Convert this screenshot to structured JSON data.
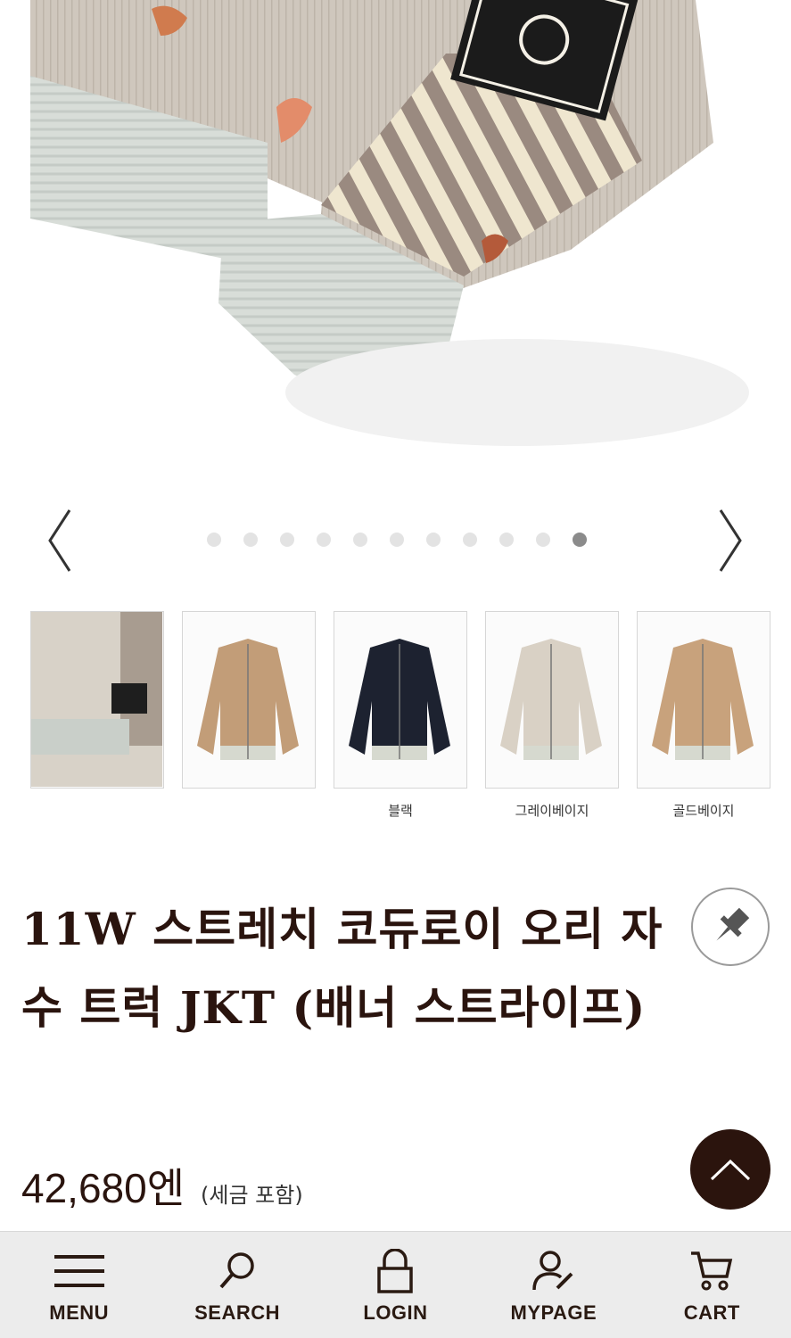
{
  "gallery": {
    "dot_count": 11,
    "active_index": 10,
    "prev_label": "previous-image",
    "next_label": "next-image"
  },
  "thumbnails": [
    {
      "label": "",
      "color": "#d8d2c8",
      "variant": "detail"
    },
    {
      "label": "",
      "color": "#c29d78",
      "variant": "tan"
    },
    {
      "label": "블랙",
      "color": "#1d2230",
      "variant": "black"
    },
    {
      "label": "그레이베이지",
      "color": "#d9d1c5",
      "variant": "greybeige"
    },
    {
      "label": "골드베이지",
      "color": "#c8a27c",
      "variant": "goldbeige"
    }
  ],
  "product": {
    "title": "11W 스트레치 코듀로이 오리 자수 트럭 JKT (배너 스트라이프)",
    "price": "42,680엔",
    "tax_note": "(세금 포함)"
  },
  "bottom_nav": {
    "items": [
      {
        "label": "MENU",
        "icon": "menu-icon"
      },
      {
        "label": "SEARCH",
        "icon": "search-icon"
      },
      {
        "label": "LOGIN",
        "icon": "lock-icon"
      },
      {
        "label": "MYPAGE",
        "icon": "user-edit-icon"
      },
      {
        "label": "CART",
        "icon": "cart-icon"
      }
    ]
  },
  "colors": {
    "brand_dark": "#2b140d",
    "nav_bg": "#ececec",
    "dot_inactive": "#e3e3e3",
    "dot_active": "#8b8b8b"
  }
}
